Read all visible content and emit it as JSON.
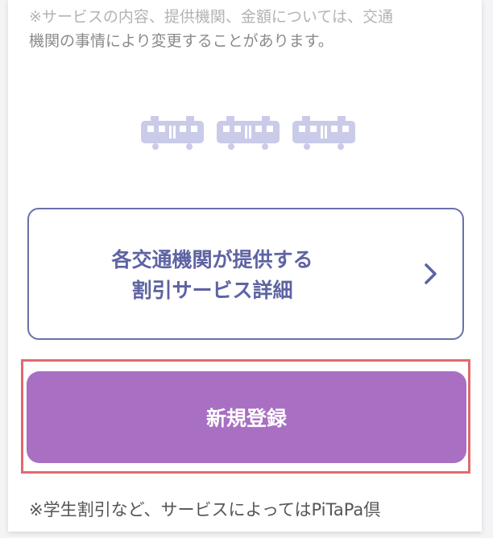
{
  "notice_top": {
    "line1": "※サービスの内容、提供機関、金額については、交通",
    "line2": "機関の事情により変更することがあります。"
  },
  "decoration": {
    "icon": "train-icon",
    "count": 3,
    "color": "#c9cbe9"
  },
  "detail_button": {
    "line1": "各交通機関が提供する",
    "line2": "割引サービス詳細",
    "icon": "chevron-right-icon",
    "border_color": "#6b70ab",
    "text_color": "#5e63a3"
  },
  "register_button": {
    "label": "新規登録",
    "bg_color": "#a86fc2",
    "highlight_color": "#e06a6e"
  },
  "notice_bottom": {
    "text": "※学生割引など、サービスによってはPiTaPa倶"
  }
}
